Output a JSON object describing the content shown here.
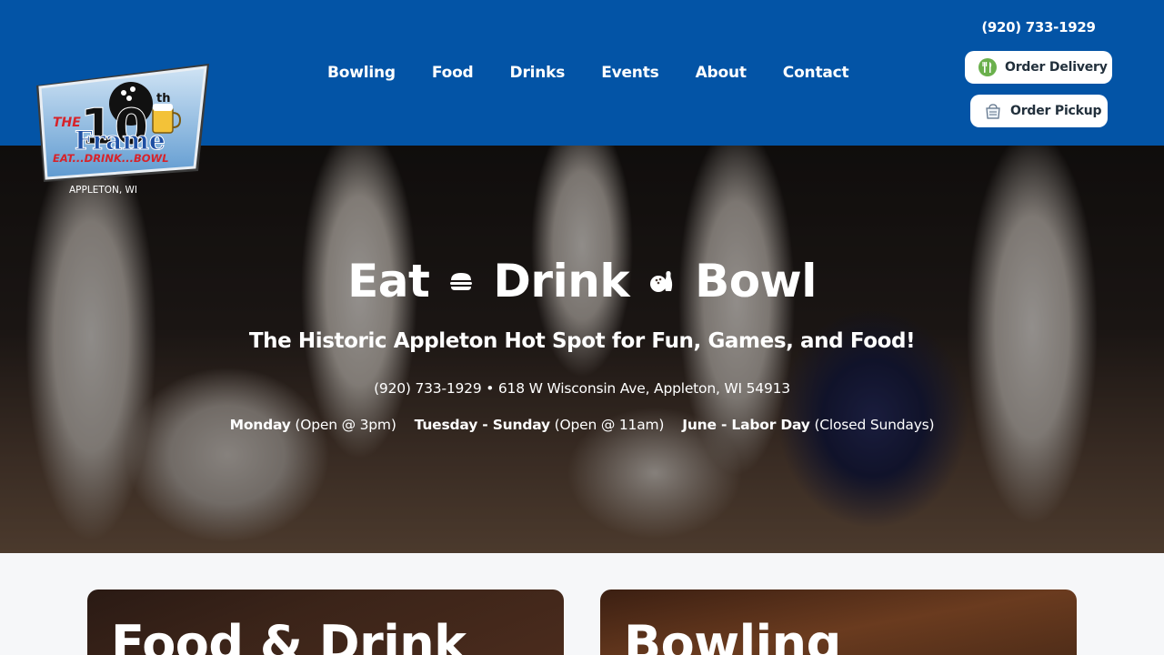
{
  "header": {
    "phone": "(920) 733-1929",
    "logo": {
      "text_the": "THE",
      "text_10": "10",
      "text_th": "th",
      "text_frame": "Frame",
      "tagline": "EAT...DRINK...BOWL",
      "location": "APPLETON, WI"
    },
    "nav": [
      {
        "label": "Bowling"
      },
      {
        "label": "Food"
      },
      {
        "label": "Drinks"
      },
      {
        "label": "Events"
      },
      {
        "label": "About"
      },
      {
        "label": "Contact"
      }
    ],
    "order_delivery_label": "Order Delivery",
    "order_pickup_label": "Order Pickup"
  },
  "hero": {
    "title_words": [
      "Eat",
      "Drink",
      "Bowl"
    ],
    "title_icons": [
      "burger-icon",
      "bowling-icon"
    ],
    "subtitle": "The Historic Appleton Hot Spot for Fun, Games, and Food!",
    "contact_line": "(920) 733-1929 • 618 W Wisconsin Ave, Appleton, WI 54913",
    "hours": [
      {
        "day": "Monday",
        "detail": "(Open @ 3pm)"
      },
      {
        "day": "Tuesday - Sunday",
        "detail": "(Open @ 11am)"
      },
      {
        "day": "June - Labor Day",
        "detail": "(Closed Sundays)"
      }
    ]
  },
  "cards": [
    {
      "title": "Food & Drink"
    },
    {
      "title": "Bowling"
    }
  ],
  "colors": {
    "header_bg": "#0354a6",
    "logo_red": "#d6232a",
    "logo_blue": "#1e4fa3"
  }
}
